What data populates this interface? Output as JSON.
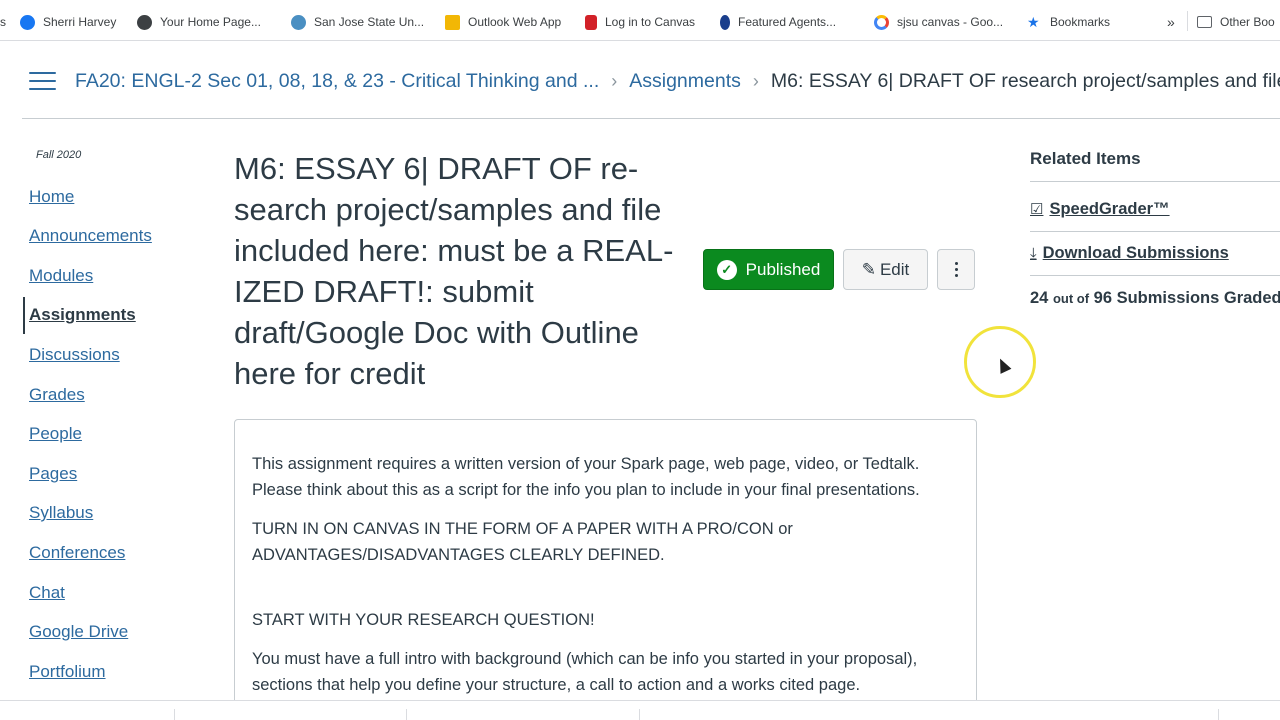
{
  "bookmarks": [
    {
      "label": "s",
      "icon": "bookmark-fragment",
      "color": "#5f6368"
    },
    {
      "label": "Sherri Harvey",
      "icon": "facebook-icon",
      "color": "#1877f2"
    },
    {
      "label": "Your Home Page...",
      "icon": "globe-icon",
      "color": "#3c4043"
    },
    {
      "label": "San Jose State Un...",
      "icon": "sjsu-icon",
      "color": "#4a8fc2"
    },
    {
      "label": "Outlook Web App",
      "icon": "outlook-icon",
      "color": "#f2b705"
    },
    {
      "label": "Log in to Canvas",
      "icon": "canvas-icon",
      "color": "#d22128"
    },
    {
      "label": "Featured Agents...",
      "icon": "agents-icon",
      "color": "#1a3e8c"
    },
    {
      "label": "sjsu canvas - Goo...",
      "icon": "google-icon",
      "color": "#4285f4"
    },
    {
      "label": "Bookmarks",
      "icon": "star-icon",
      "color": "#1a73e8"
    },
    {
      "label": "»",
      "icon": "overflow-chevron-icon",
      "color": "#5f6368"
    },
    {
      "label": "Other Boo",
      "icon": "folder-icon",
      "color": "#5f6368"
    }
  ],
  "header": {
    "breadcrumbs": [
      {
        "label": "FA20: ENGL-2 Sec 01, 08, 18, & 23 - Critical Thinking and ..."
      },
      {
        "label": "Assignments"
      },
      {
        "label": "M6: ESSAY 6| DRAFT OF research project/samples and file."
      }
    ],
    "separator": "›"
  },
  "course_nav": {
    "term": "Fall 2020",
    "items": [
      {
        "label": "Home"
      },
      {
        "label": "Announcements"
      },
      {
        "label": "Modules"
      },
      {
        "label": "Assignments",
        "active": true
      },
      {
        "label": "Discussions"
      },
      {
        "label": "Grades"
      },
      {
        "label": "People"
      },
      {
        "label": "Pages"
      },
      {
        "label": "Syllabus"
      },
      {
        "label": "Conferences"
      },
      {
        "label": "Chat"
      },
      {
        "label": "Google Drive"
      },
      {
        "label": "Portfolium"
      }
    ]
  },
  "assignment": {
    "title": "M6: ESSAY 6| DRAFT OF re-search project/samples and file included here: must be a REAL-IZED DRAFT!: submit draft/Google Doc with Outline here for credit",
    "title_lines": [
      "M6: ESSAY 6| DRAFT OF re-",
      "search project/samples and file",
      "included here: must be a REAL-",
      "IZED DRAFT!: submit",
      "draft/Google Doc with Outline",
      "here for credit"
    ],
    "published_label": "Published",
    "edit_label": "Edit",
    "description": [
      "This assignment requires a written version of your Spark page, web page, video, or Tedtalk. Please think about this as a script for the info you plan to include in your final presentations.",
      "TURN IN ON CANVAS IN THE FORM OF A PAPER WITH A PRO/CON or ADVANTAGES/DISADVANTAGES CLEARLY DEFINED.",
      "START WITH YOUR RESEARCH QUESTION!",
      "You must have a full intro with background (which can be info you started in your proposal), sections that help you define your structure, a call to action and a works cited page."
    ]
  },
  "related": {
    "title": "Related Items",
    "speedgrader_label": "SpeedGrader™",
    "download_label": "Download Submissions",
    "graded_count": "24",
    "out_of_label": "out of",
    "total_count": "96",
    "graded_suffix": "Submissions Graded"
  },
  "colors": {
    "link": "#2d6a9f",
    "text": "#2d3b45",
    "published_green": "#0b8a1f",
    "cursor_highlight": "#f1e33b"
  }
}
